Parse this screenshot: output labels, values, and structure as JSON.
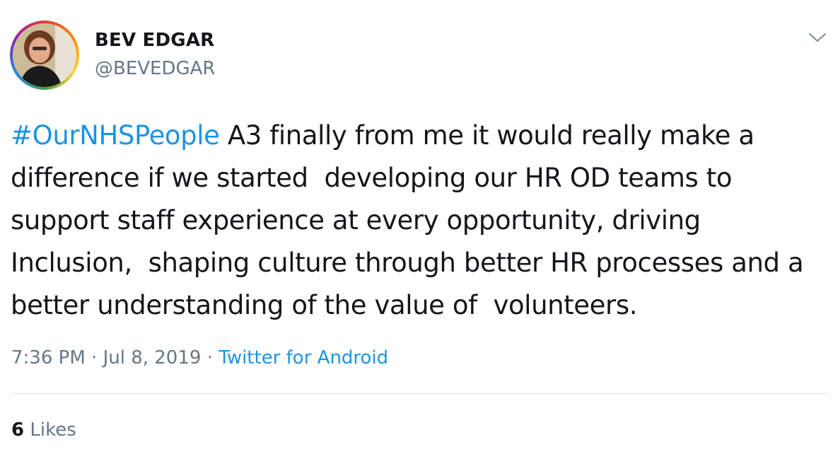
{
  "tweet": {
    "author": {
      "display_name": "BEV EDGAR",
      "handle": "@BEVEDGAR",
      "avatar": "profile-photo"
    },
    "hashtag": "#OurNHSPeople",
    "body": " A3 finally from me it would really make a difference if we started  developing our HR OD teams to support staff experience at every opportunity, driving Inclusion,  shaping culture through better HR processes and a better understanding of the value of  volunteers.",
    "time": "7:36 PM",
    "separator": " · ",
    "date": "Jul 8, 2019",
    "source": "Twitter for Android",
    "likes_count": "6",
    "likes_label": " Likes",
    "menu_icon": "chevron-down-icon"
  },
  "colors": {
    "link": "#1b95e0",
    "text": "#14171a",
    "secondary": "#657786",
    "divider": "#e1e8ed"
  }
}
